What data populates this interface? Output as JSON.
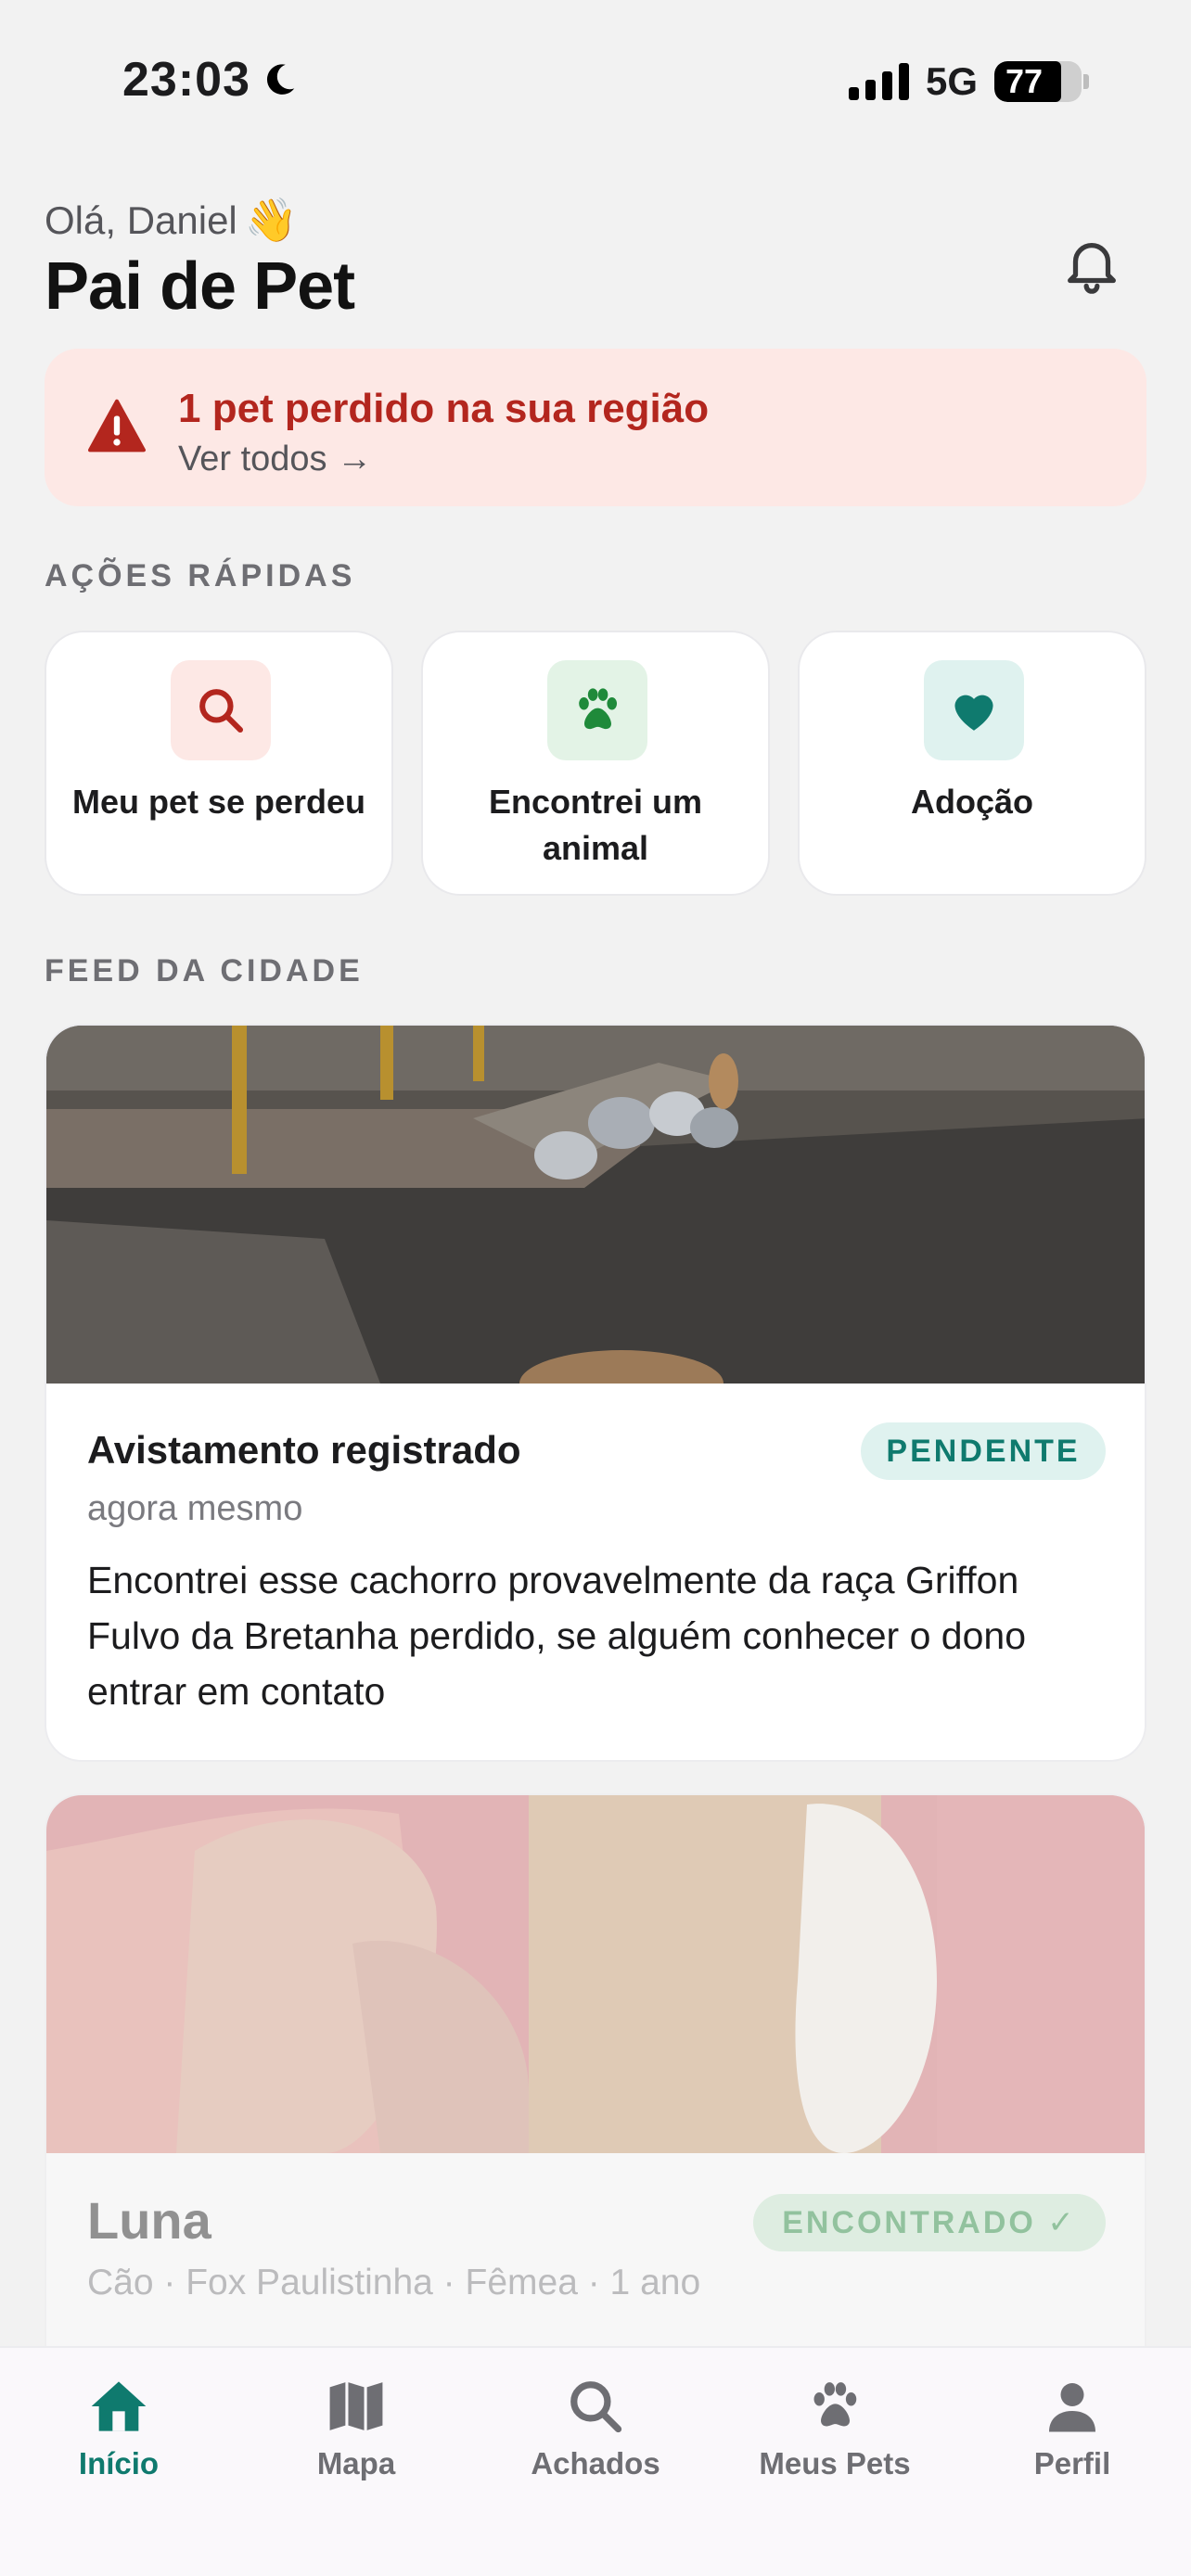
{
  "status_bar": {
    "time": "23:03",
    "network": "5G",
    "battery": "77",
    "battery_level_percent": 77
  },
  "header": {
    "greeting": "Olá, Daniel",
    "greeting_emoji": "👋",
    "title": "Pai de Pet",
    "notification_icon": "bell-icon"
  },
  "alert": {
    "title": "1 pet perdido na sua região",
    "link": "Ver todos →",
    "icon": "warning-icon",
    "color": "#b3261e",
    "background": "#fde8e5"
  },
  "quick_actions": {
    "label": "AÇÕES RÁPIDAS",
    "items": [
      {
        "label": "Meu pet se perdeu",
        "icon": "search-icon",
        "icon_bg": "#fde8e5",
        "icon_color": "#b3261e"
      },
      {
        "label": "Encontrei um animal",
        "icon": "paw-icon",
        "icon_bg": "#e3f3e6",
        "icon_color": "#1f8a3a"
      },
      {
        "label": "Adoção",
        "icon": "heart-icon",
        "icon_bg": "#dff2ef",
        "icon_color": "#0f7a6e"
      }
    ]
  },
  "feed": {
    "label": "FEED DA CIDADE",
    "posts": [
      {
        "title": "Avistamento registrado",
        "time": "agora mesmo",
        "status": "PENDENTE",
        "description": "Encontrei esse cachorro provavelmente da raça Griffon Fulvo da Bretanha perdido, se alguém conhecer o dono entrar em contato"
      },
      {
        "title": "Luna",
        "status": "ENCONTRADO ✓",
        "details": "Cão · Fox Paulistinha · Fêmea · 1 ano"
      }
    ]
  },
  "tabbar": {
    "items": [
      {
        "label": "Início",
        "icon": "home-icon",
        "active": true
      },
      {
        "label": "Mapa",
        "icon": "map-icon",
        "active": false
      },
      {
        "label": "Achados",
        "icon": "search-icon",
        "active": false
      },
      {
        "label": "Meus Pets",
        "icon": "paw-icon",
        "active": false
      },
      {
        "label": "Perfil",
        "icon": "person-icon",
        "active": false
      }
    ]
  },
  "colors": {
    "accent": "#0f7a6e",
    "danger": "#b3261e",
    "background": "#f2f2f2"
  }
}
